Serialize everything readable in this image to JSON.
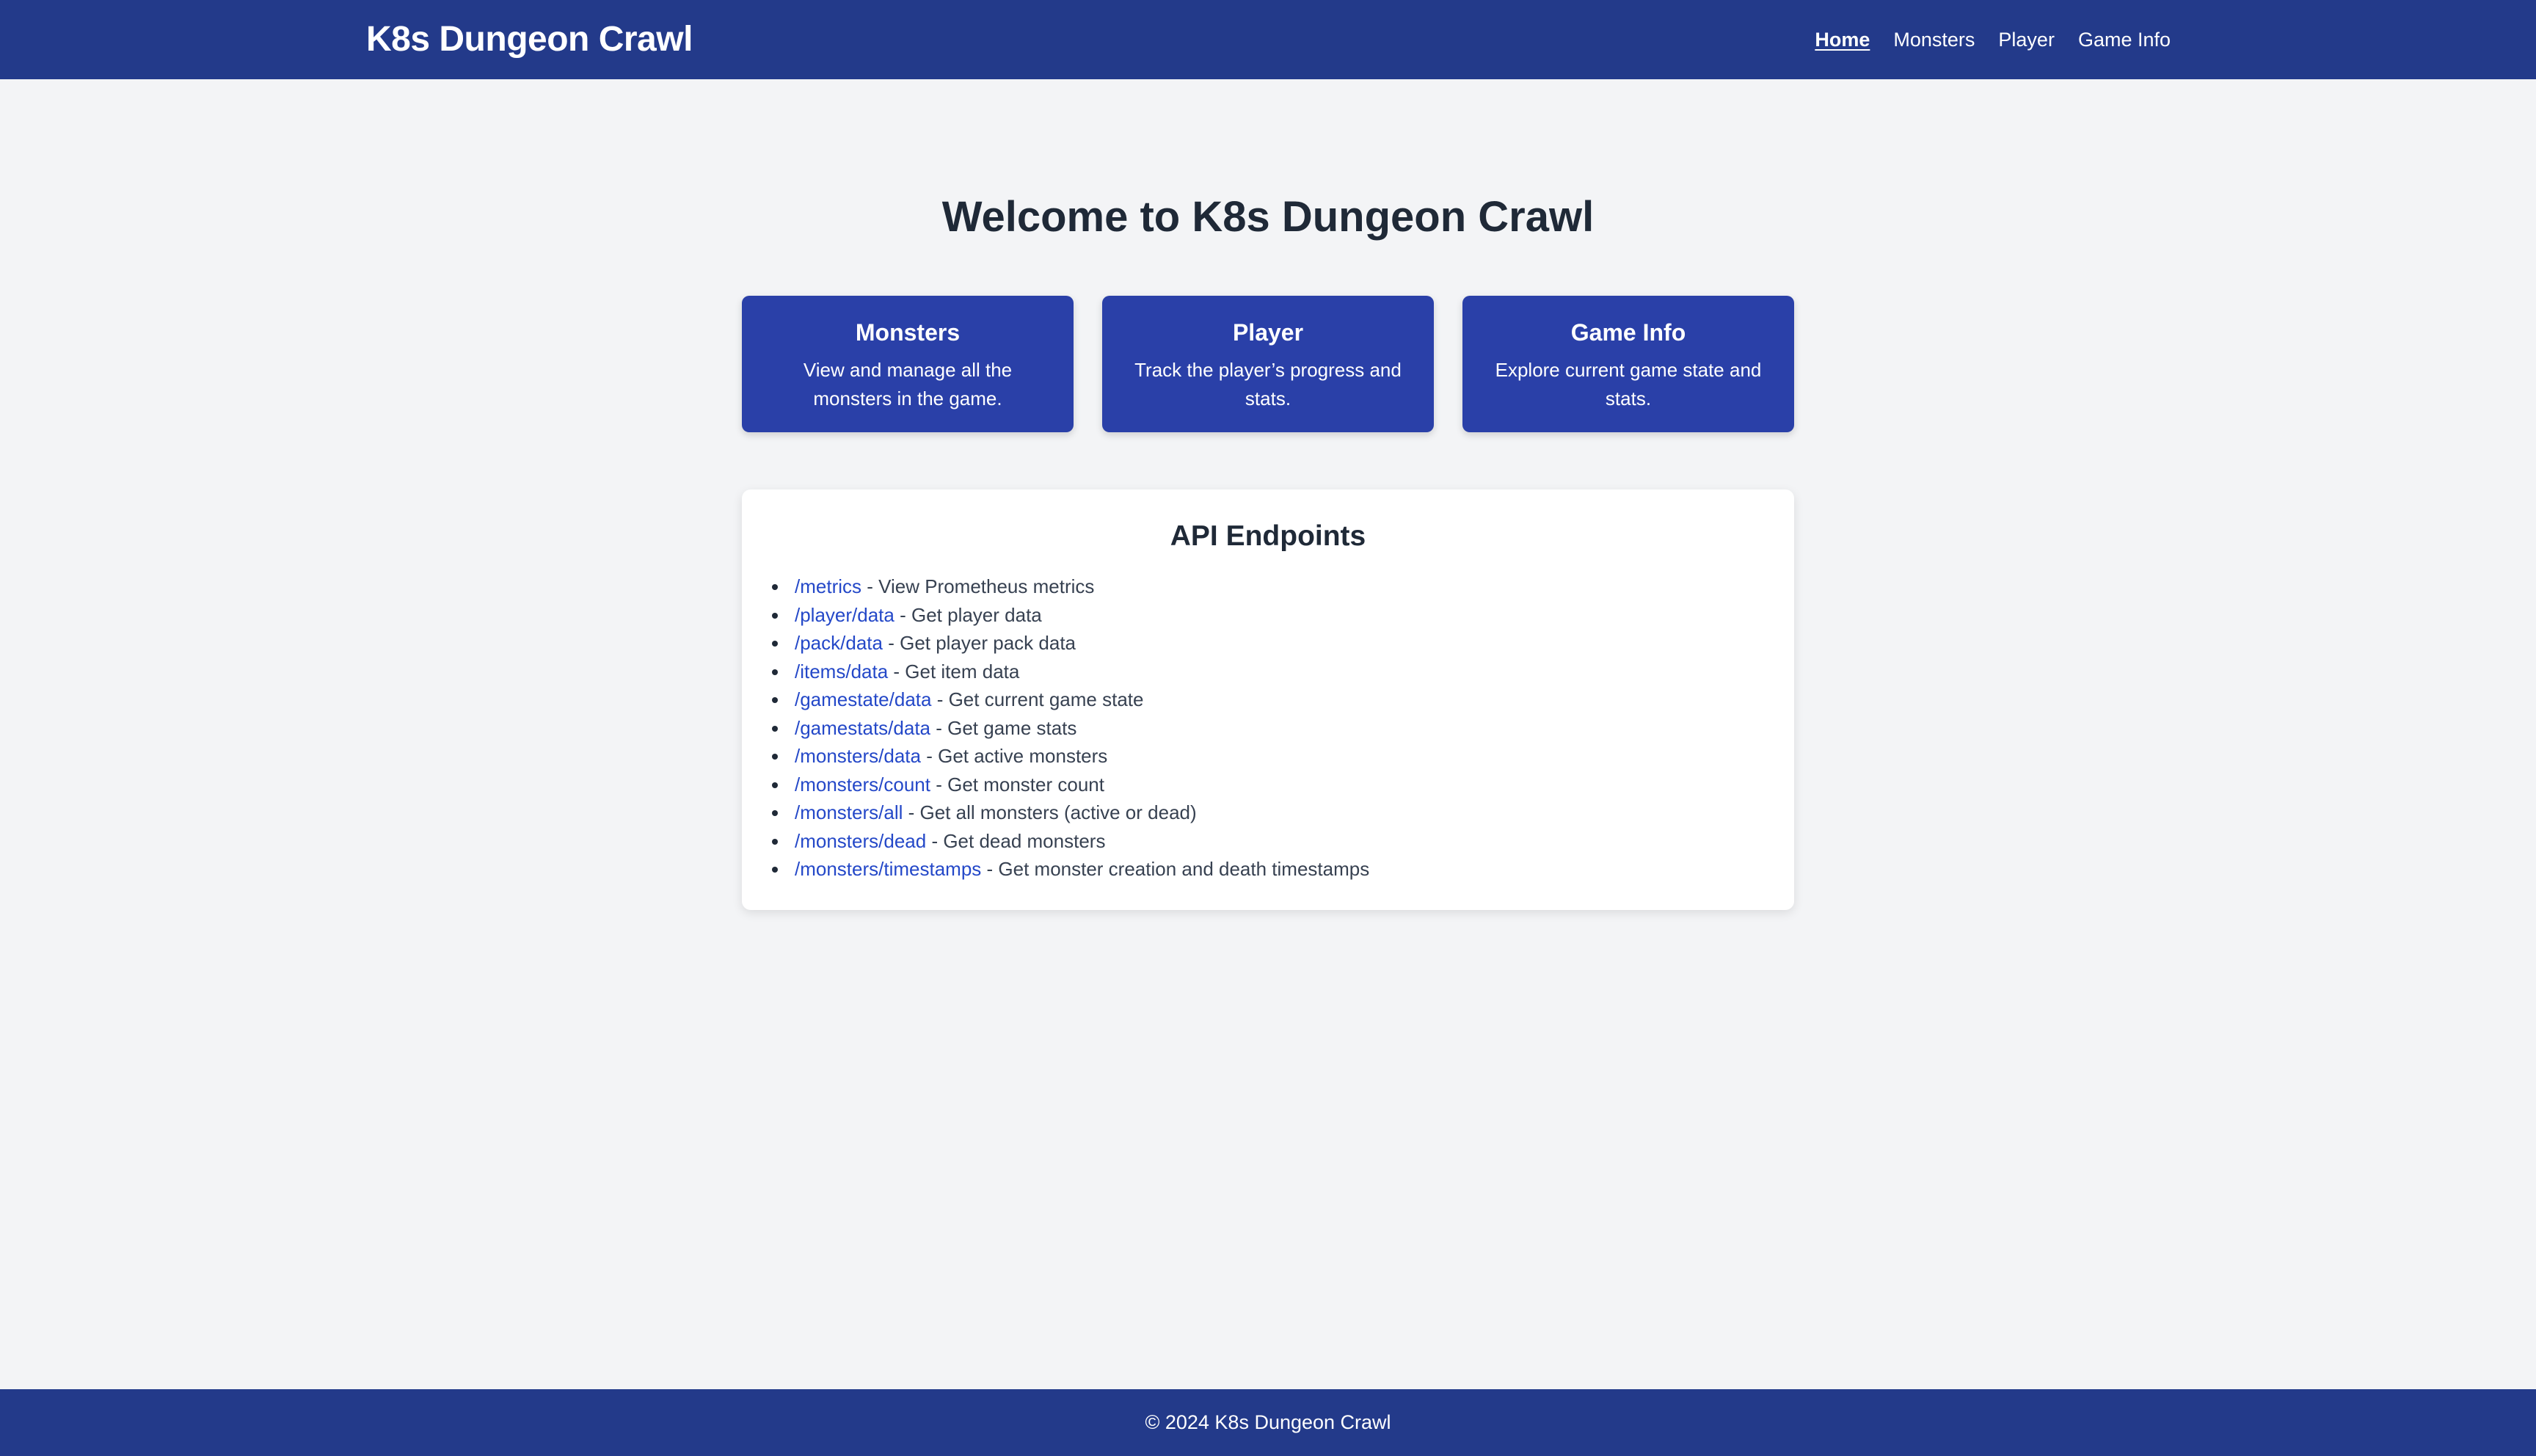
{
  "header": {
    "brand": "K8s Dungeon Crawl",
    "nav": [
      {
        "label": "Home",
        "active": true
      },
      {
        "label": "Monsters",
        "active": false
      },
      {
        "label": "Player",
        "active": false
      },
      {
        "label": "Game Info",
        "active": false
      }
    ]
  },
  "main": {
    "title": "Welcome to K8s Dungeon Crawl",
    "cards": [
      {
        "title": "Monsters",
        "description": "View and manage all the monsters in the game."
      },
      {
        "title": "Player",
        "description": "Track the player’s progress and stats."
      },
      {
        "title": "Game Info",
        "description": "Explore current game state and stats."
      }
    ],
    "api": {
      "title": "API Endpoints",
      "endpoints": [
        {
          "path": "/metrics",
          "desc": " - View Prometheus metrics"
        },
        {
          "path": "/player/data",
          "desc": " - Get player data"
        },
        {
          "path": "/pack/data",
          "desc": " - Get player pack data"
        },
        {
          "path": "/items/data",
          "desc": " - Get item data"
        },
        {
          "path": "/gamestate/data",
          "desc": " - Get current game state"
        },
        {
          "path": "/gamestats/data",
          "desc": " - Get game stats"
        },
        {
          "path": "/monsters/data",
          "desc": " - Get active monsters"
        },
        {
          "path": "/monsters/count",
          "desc": " - Get monster count"
        },
        {
          "path": "/monsters/all",
          "desc": " - Get all monsters (active or dead)"
        },
        {
          "path": "/monsters/dead",
          "desc": " - Get dead monsters"
        },
        {
          "path": "/monsters/timestamps",
          "desc": " - Get monster creation and death timestamps"
        }
      ]
    }
  },
  "footer": {
    "copyright": "© 2024 K8s Dungeon Crawl"
  },
  "colors": {
    "header_bg": "#233a8a",
    "card_bg": "#2a40a8",
    "link": "#2448c8",
    "page_bg": "#f3f4f6"
  }
}
